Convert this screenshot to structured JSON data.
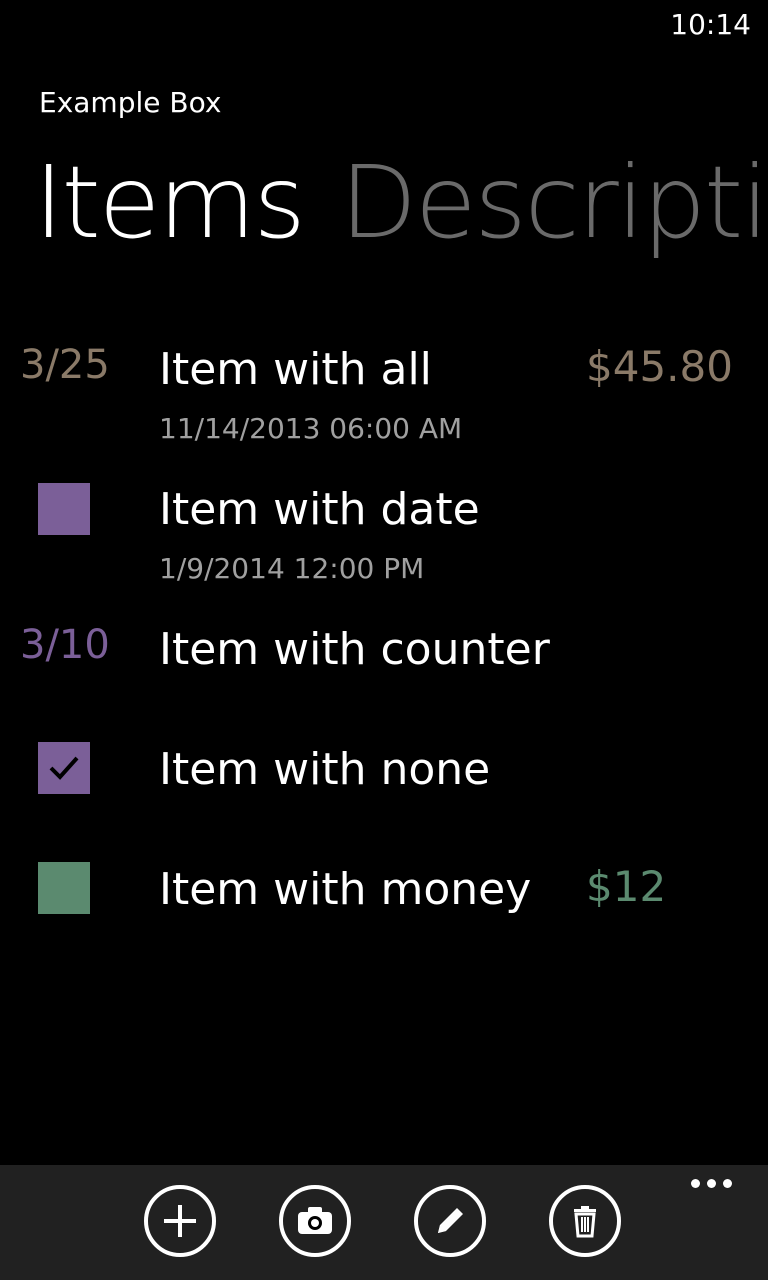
{
  "status": {
    "time": "10:14"
  },
  "app": {
    "title": "Example Box"
  },
  "pivot": {
    "items_label": "Items",
    "description_label": "Descripti"
  },
  "colors": {
    "tan": "#8a7a68",
    "purple": "#7b5f98",
    "green": "#5b8a6f",
    "appbar": "#212121"
  },
  "items": [
    {
      "lead": "3/25",
      "name": "Item with all",
      "date": "11/14/2013 06:00 AM",
      "amount": "$45.80"
    },
    {
      "lead_icon": "purple-square-icon",
      "name": "Item with date",
      "date": "1/9/2014 12:00 PM"
    },
    {
      "lead": "3/10",
      "name": "Item with counter"
    },
    {
      "lead_icon": "checkbox-checked-icon",
      "name": "Item with none"
    },
    {
      "lead_icon": "green-square-icon",
      "name": "Item with money",
      "amount": "$12"
    }
  ],
  "appbar": {
    "buttons": [
      "add-icon",
      "camera-icon",
      "edit-icon",
      "delete-icon"
    ],
    "more": "more-icon"
  }
}
